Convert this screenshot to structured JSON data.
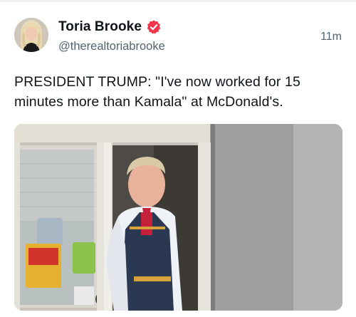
{
  "post": {
    "author": {
      "display_name": "Toria Brooke",
      "handle": "@therealtoriabrooke",
      "verified": true,
      "verified_color": "#f3364a"
    },
    "timestamp": "11m",
    "text": "PRESIDENT TRUMP: \"I've now worked for 15 minutes more than Kamala\" at McDonald's.",
    "media": {
      "type": "photo",
      "icon": "photo-icon"
    }
  }
}
